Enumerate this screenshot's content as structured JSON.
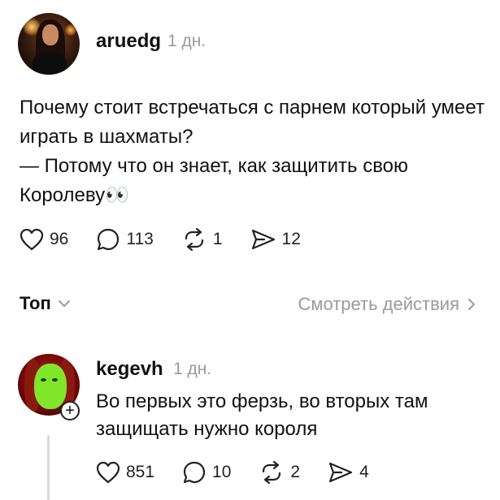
{
  "post": {
    "username": "aruedg",
    "time": "1 дн.",
    "text": "Почему стоит встречаться с парнем который умеет играть в шахматы?\n— Потому что он знает, как защитить свою Королеву👀",
    "likes": "96",
    "comments": "113",
    "reposts": "1",
    "shares": "12"
  },
  "sort": {
    "label": "Топ",
    "view_activity": "Смотреть действия"
  },
  "reply": {
    "username": "kegevh",
    "time": "1 дн.",
    "text": "Во первых это ферзь, во вторых там\nзащищать нужно короля",
    "likes": "851",
    "comments": "10",
    "reposts": "2",
    "shares": "4",
    "follow_badge": "+"
  },
  "icons": [
    "heart-icon",
    "comment-icon",
    "repost-icon",
    "share-icon",
    "chevron-down-icon",
    "chevron-right-icon",
    "plus-icon"
  ]
}
